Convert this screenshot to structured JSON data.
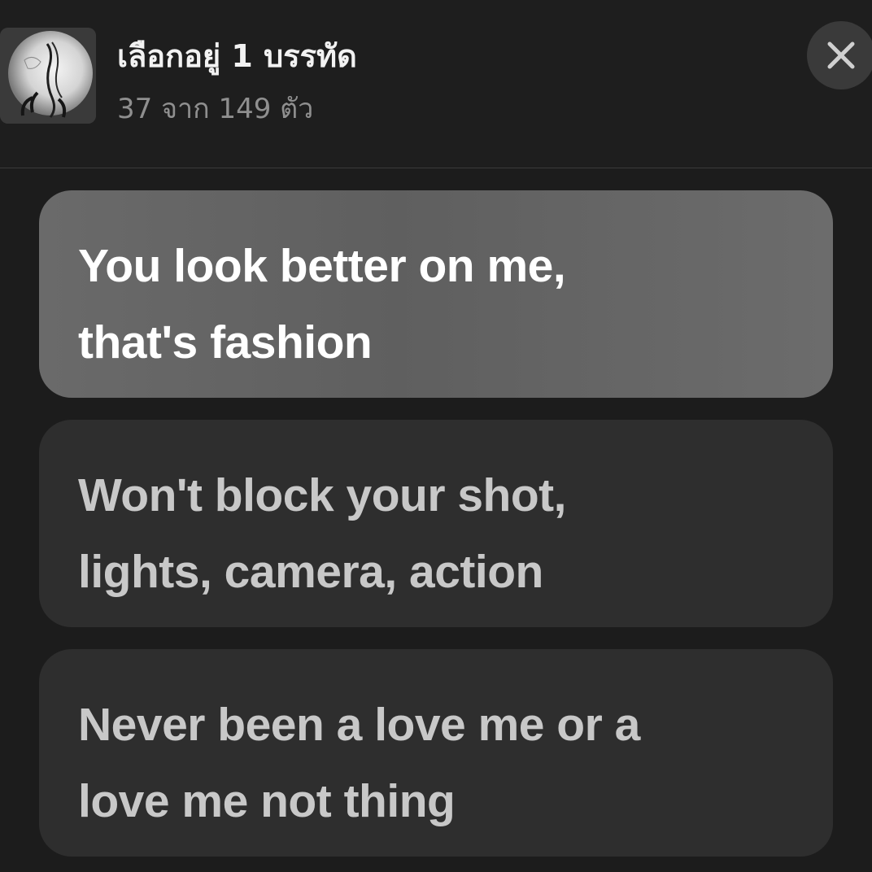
{
  "header": {
    "title": "เลือกอยู่ 1 บรรทัด",
    "subtitle": "37 จาก 149 ตัว",
    "artwork_icon": "album-art",
    "close_icon": "close-icon"
  },
  "lyrics": [
    {
      "lines": [
        "You look better on me,",
        "that's fashion"
      ],
      "selected": true
    },
    {
      "lines": [
        "Won't block your shot,",
        "lights, camera, action"
      ],
      "selected": false
    },
    {
      "lines": [
        "Never been a love me or a",
        "love me not thing"
      ],
      "selected": false
    }
  ],
  "colors": {
    "background": "#1c1c1c",
    "card": "#2e2e2e",
    "card_selected": "#666666",
    "text_selected": "#ffffff",
    "text_unselected": "#c8c8c8",
    "subtitle": "#8f8f8f"
  }
}
